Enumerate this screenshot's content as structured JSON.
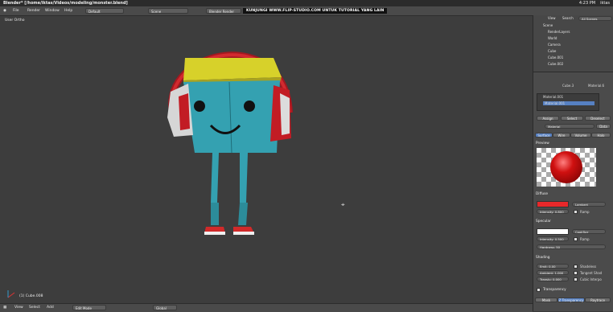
{
  "titlebar": {
    "title": "Blender* [/home/iktas/Videos/modeling/monster.blend]",
    "time": "4:23 PM",
    "user": "iktas"
  },
  "menu": {
    "file": "File",
    "render": "Render",
    "window": "Window",
    "help": "Help",
    "layout": "Default",
    "scene": "Scene",
    "engine": "Blender Render"
  },
  "banner": "KUNJUNGI WWW.FLIP-STUDIO.COM UNTUK TUTORIAL YANG LAIN",
  "viewport": {
    "label": "User Ortho",
    "object_label": "(1) Cube.008"
  },
  "header3d": {
    "view": "View",
    "select": "Select",
    "add": "Add",
    "mode": "Edit Mode",
    "pivot": "Global"
  },
  "outliner": {
    "view": "View",
    "search": "Search",
    "scenes": "All Scenes",
    "rows": [
      "Scene",
      "RenderLayers",
      "World",
      "Camera",
      "Cube",
      "Cube.001",
      "Cube.002"
    ]
  },
  "properties": {
    "object_name": "Cube.3",
    "material_slot": "Material.6",
    "slots": [
      "Material.001",
      "Material.001"
    ],
    "assign": "Assign",
    "select": "Select",
    "deselect": "Deselect",
    "material_name": "Material",
    "data": "Data",
    "tabs": [
      "Surface",
      "Wire",
      "Volume",
      "Halo"
    ],
    "preview": "Preview",
    "diffuse": "Diffuse",
    "diffuse_shader": "Lambert",
    "intensity": "Intensity: 0.800",
    "ramp": "Ramp",
    "specular": "Specular",
    "spec_shader": "CookTorr",
    "spec_intensity": "Intensity: 0.500",
    "hardness": "Hardness: 50",
    "shading": "Shading",
    "emit": "Emit: 0.00",
    "ambient": "Ambient: 1.000",
    "translucency": "Translu: 0.000",
    "shadeless": "Shadeless",
    "tangent": "Tangent Shad",
    "cubic": "Cubic Interpo",
    "transparency": "Transparency",
    "bottom_tabs": [
      "Mask",
      "Z Transparency",
      "Raytrace"
    ],
    "colors": {
      "diffuse": "#e8282a",
      "specular": "#ffffff",
      "accent": "#5680c2"
    }
  }
}
